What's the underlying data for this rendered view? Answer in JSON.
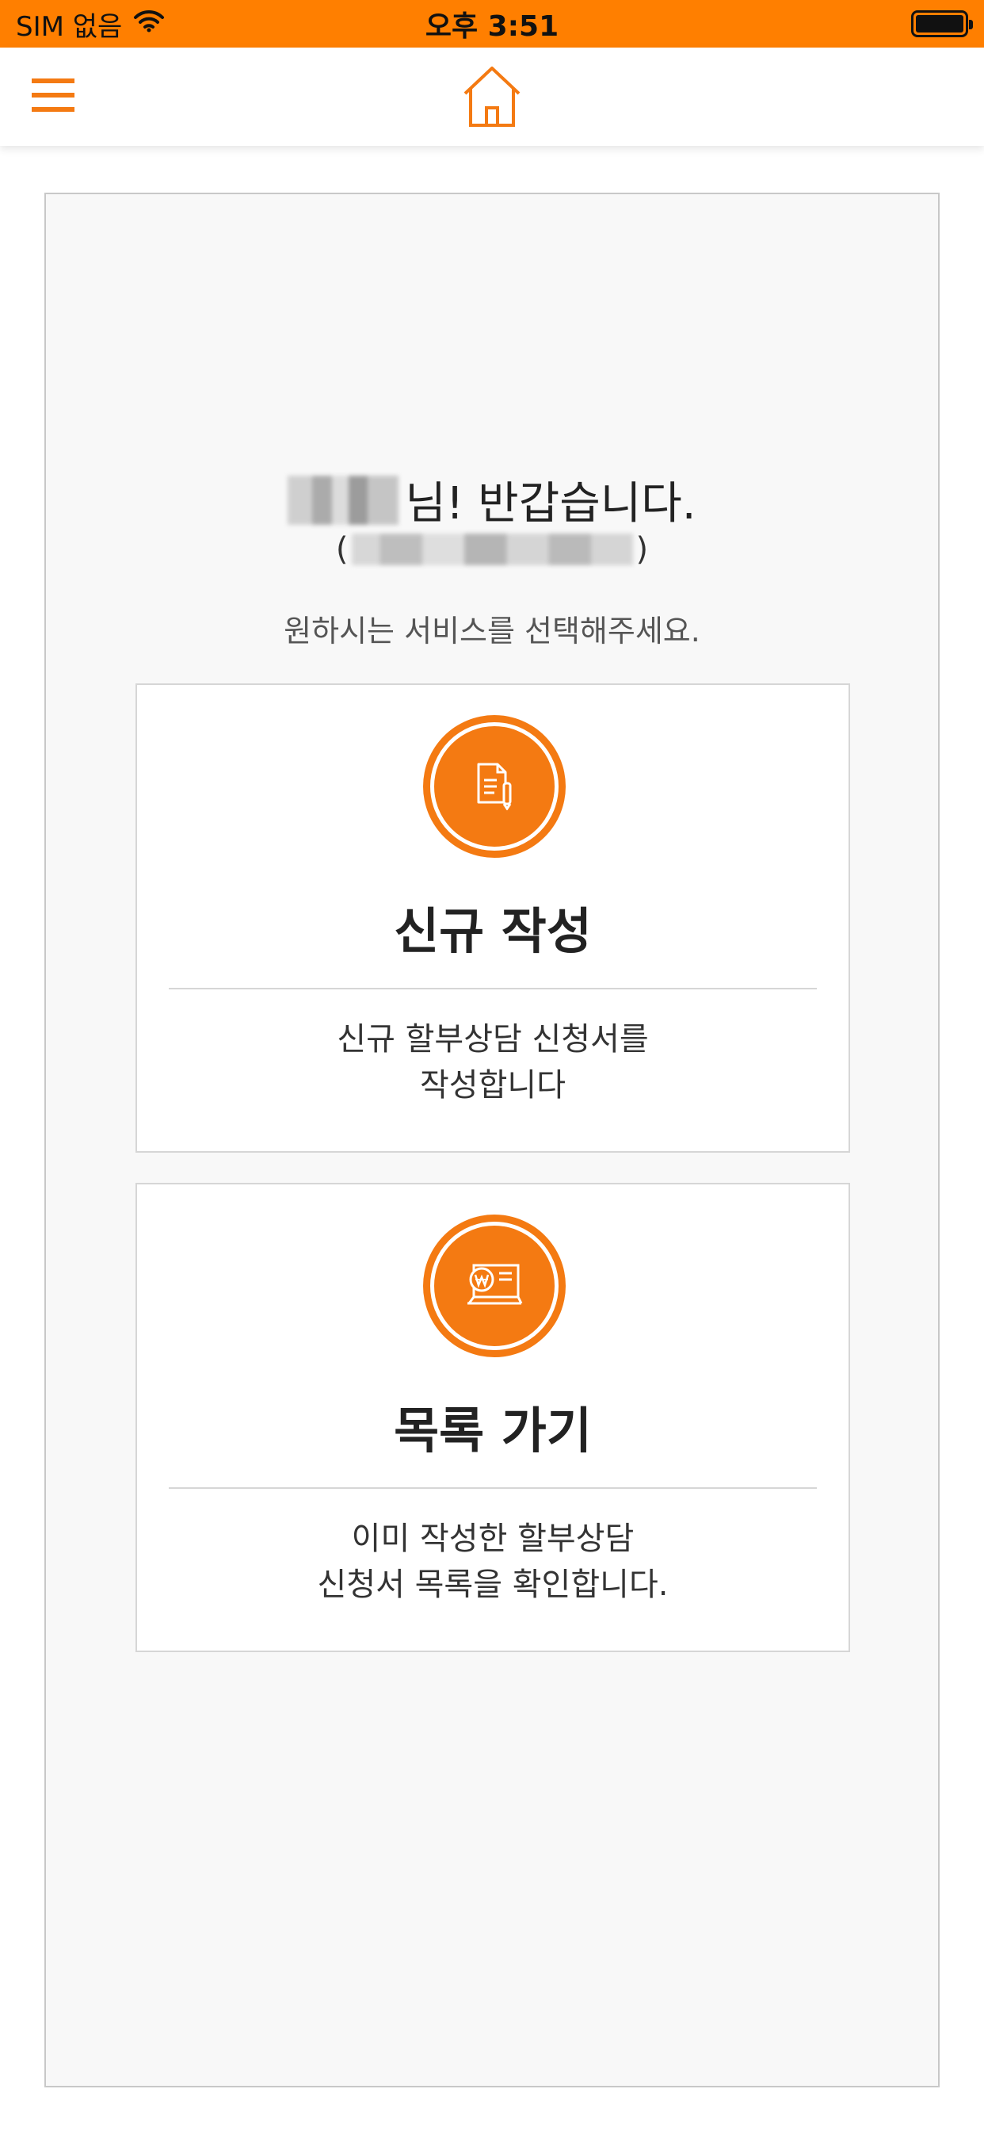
{
  "status_bar": {
    "carrier": "SIM 없음",
    "time": "오후 3:51",
    "battery_level": 1.0
  },
  "nav": {
    "menu_icon": "hamburger-menu-icon",
    "home_icon": "home-icon"
  },
  "colors": {
    "accent": "#ff7f00",
    "circle": "#f47a12",
    "panel_bg": "#f8f8f8"
  },
  "welcome": {
    "name_suffix": "님! 반갑습니다.",
    "id_open": "(",
    "id_close": ")",
    "instruction": "원하시는 서비스를 선택해주세요."
  },
  "cards": [
    {
      "icon": "document-pen-icon",
      "title": "신규 작성",
      "desc_line1": "신규 할부상담 신청서를",
      "desc_line2": "작성합니다"
    },
    {
      "icon": "won-monitor-icon",
      "title": "목록 가기",
      "desc_line1": "이미 작성한 할부상담",
      "desc_line2": "신청서 목록을 확인합니다."
    }
  ]
}
